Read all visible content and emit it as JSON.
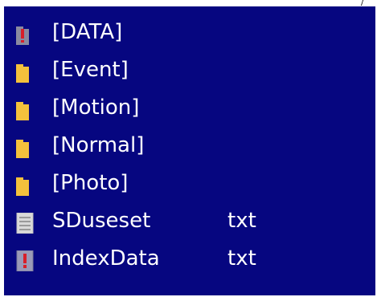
{
  "colors": {
    "background": "#060680",
    "text": "#ffffff",
    "folder": "#f4c13c",
    "folder_gray": "#8a8aa0",
    "alert_red": "#d81f2a",
    "doc_gray": "#d9d9d9"
  },
  "corner_mark": "/",
  "files": [
    {
      "name": "[DATA]",
      "ext": "",
      "icon": "folder-alert-icon"
    },
    {
      "name": "[Event]",
      "ext": "",
      "icon": "folder-icon"
    },
    {
      "name": "[Motion]",
      "ext": "",
      "icon": "folder-icon"
    },
    {
      "name": "[Normal]",
      "ext": "",
      "icon": "folder-icon"
    },
    {
      "name": "[Photo]",
      "ext": "",
      "icon": "folder-icon"
    },
    {
      "name": "SDuseset",
      "ext": "txt",
      "icon": "text-file-icon"
    },
    {
      "name": "IndexData",
      "ext": "txt",
      "icon": "text-file-alert-icon"
    }
  ]
}
